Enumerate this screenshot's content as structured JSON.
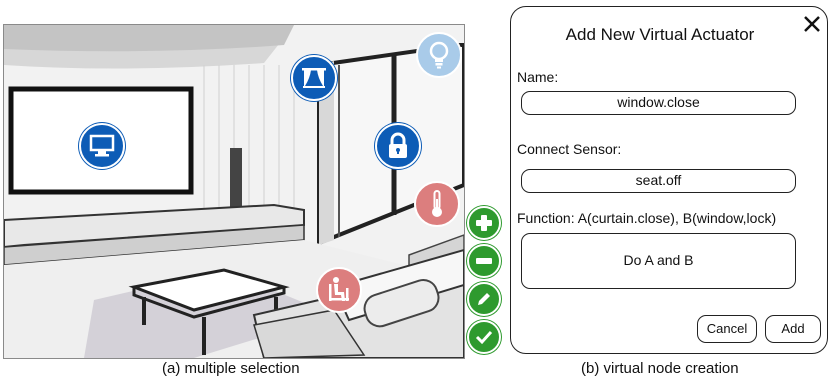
{
  "scene": {
    "nodes": {
      "tv": "tv-icon",
      "curtain": "curtain-icon",
      "lamp": "lightbulb-icon",
      "lock": "lock-icon",
      "thermometer": "thermometer-icon",
      "seat": "seated-person-icon"
    },
    "tools": {
      "add": "plus-icon",
      "remove": "minus-icon",
      "edit": "pencil-icon",
      "confirm": "check-icon"
    },
    "colors": {
      "selected_node": "#0d5cb6",
      "inactive_node": "#a9cbe9",
      "sensor_node": "#dc7e7e",
      "tool_button": "#2e9a2e"
    }
  },
  "dialog": {
    "title": "Add New Virtual Actuator",
    "close_icon": "close-icon",
    "name_label": "Name:",
    "name_value": "window.close",
    "sensor_label": "Connect Sensor:",
    "sensor_value": "seat.off",
    "function_label": "Function: A(curtain.close), B(window,lock)",
    "function_value": "Do A and B",
    "cancel_label": "Cancel",
    "add_label": "Add"
  },
  "captions": {
    "left": "(a) multiple selection",
    "right": "(b) virtual node creation"
  }
}
